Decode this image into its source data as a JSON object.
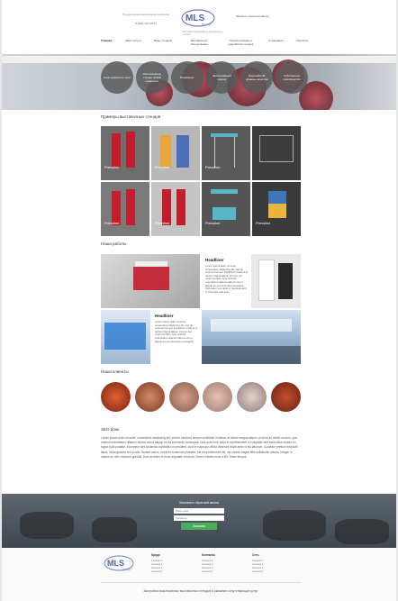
{
  "header": {
    "tagline": "Профессиональная фирма компании",
    "phone": "8 (495) 123-45-67",
    "logo_text": "MLS",
    "logo_sub": "group",
    "logo_caption": "Застройка эксклюзивных выставочных стендов",
    "callback_label": "Заказать обратный звонок"
  },
  "nav": [
    "Главная",
    "Наши услуги",
    "Виды стендов",
    "Выставочное оборудование",
    "Проектирование и разработка стендов",
    "О компании",
    "Контакты"
  ],
  "hero": {
    "circles": [
      "Срок принятия в срок",
      "Эксклюзивные стенды любой сложности",
      "Инновации",
      "Эксклюзивный подход",
      "Европейский уровень качества",
      "Собственное производство"
    ]
  },
  "sections": {
    "examples_title": "Примеры выставочных стендов",
    "works_title": "Наши работы",
    "clients_title": "Наши клиенты",
    "seo_title": "SEO блок"
  },
  "examples": [
    {
      "cap": "Pressline",
      "sub": ""
    },
    {
      "cap": "Pressline",
      "sub": ""
    },
    {
      "cap": "Pressline",
      "sub": ""
    },
    {
      "cap": "",
      "sub": ""
    },
    {
      "cap": "Pressline",
      "sub": ""
    },
    {
      "cap": "Pressline",
      "sub": ""
    },
    {
      "cap": "Pressline",
      "sub": ""
    },
    {
      "cap": "Pressline",
      "sub": ""
    }
  ],
  "works": [
    {
      "title": "Headliner",
      "text": "Lorem ipsum dolor sit amet, consectetur adipiscing elit, sed do eiusmod tempor incididunt ut labore et dolore magna aliqua. Ut enim ad minim veniam, quis nostrud exercitation ullamco laboris nisi ut aliquip ex ea commodo consequat. Duis aute irure dolor in reprehenderit in voluptate velit esse."
    },
    {
      "title": "Headliner",
      "text": "Lorem ipsum dolor sit amet, consectetur adipiscing elit, sed do eiusmod tempor incididunt ut labore et dolore magna aliqua. Ut enim ad minim veniam, quis nostrud exercitation ullamco laboris nisi ut aliquip ex ea commodo consequat."
    }
  ],
  "seo_text": "Lorem ipsum dolor sit amet, consectetur adipiscing elit, sed do eiusmod tempor incididunt ut labore et dolore magna aliqua. Ut enim ad minim veniam, quis nostrud exercitation ullamco laboris nisi ut aliquip ex ea commodo consequat. Duis aute irure dolor in reprehenderit in voluptate velit esse cillum dolore eu fugiat nulla pariatur. Excepteur sint occaecat cupidatat non proident, sunt in culpa qui officia deserunt mollit anim id est laborum. Curabitur pretium tincidunt lacus. Nulla gravida orci a odio. Nullam varius, turpis et commodo pharetra, est eros bibendum elit, nec luctus magna felis sollicitudin mauris. Integer in mauris eu nibh euismod gravida. Duis ac tellus et risus vulputate vehicula. Donec lobortis risus a elit. Etiam tempor.",
  "cta": {
    "title": "Заполните обратный звонок",
    "name_placeholder": "Ваше имя",
    "phone_placeholder": "Телефон",
    "button": "Заказать"
  },
  "footer": {
    "col1": {
      "head": "Кредо",
      "items": [
        "Ссылка 1",
        "Ссылка 2",
        "Ссылка 3",
        "Ссылка 4"
      ]
    },
    "col2": {
      "head": "Контакты",
      "items": [
        "Ссылка 1",
        "Ссылка 2",
        "Ссылка 3",
        "Ссылка 4"
      ]
    },
    "col3": {
      "head": "Сеть",
      "items": [
        "Ссылка 1",
        "Ссылка 2",
        "Ссылка 3",
        "Ссылка 4"
      ]
    },
    "bottom": "Застройка эксклюзивных выставочных стендов и оказание сопутствующих услуг"
  },
  "colors": {
    "accent_red": "#c31c2d",
    "green_button": "#4cae5a",
    "circle_gray": "#5a5a5a"
  }
}
